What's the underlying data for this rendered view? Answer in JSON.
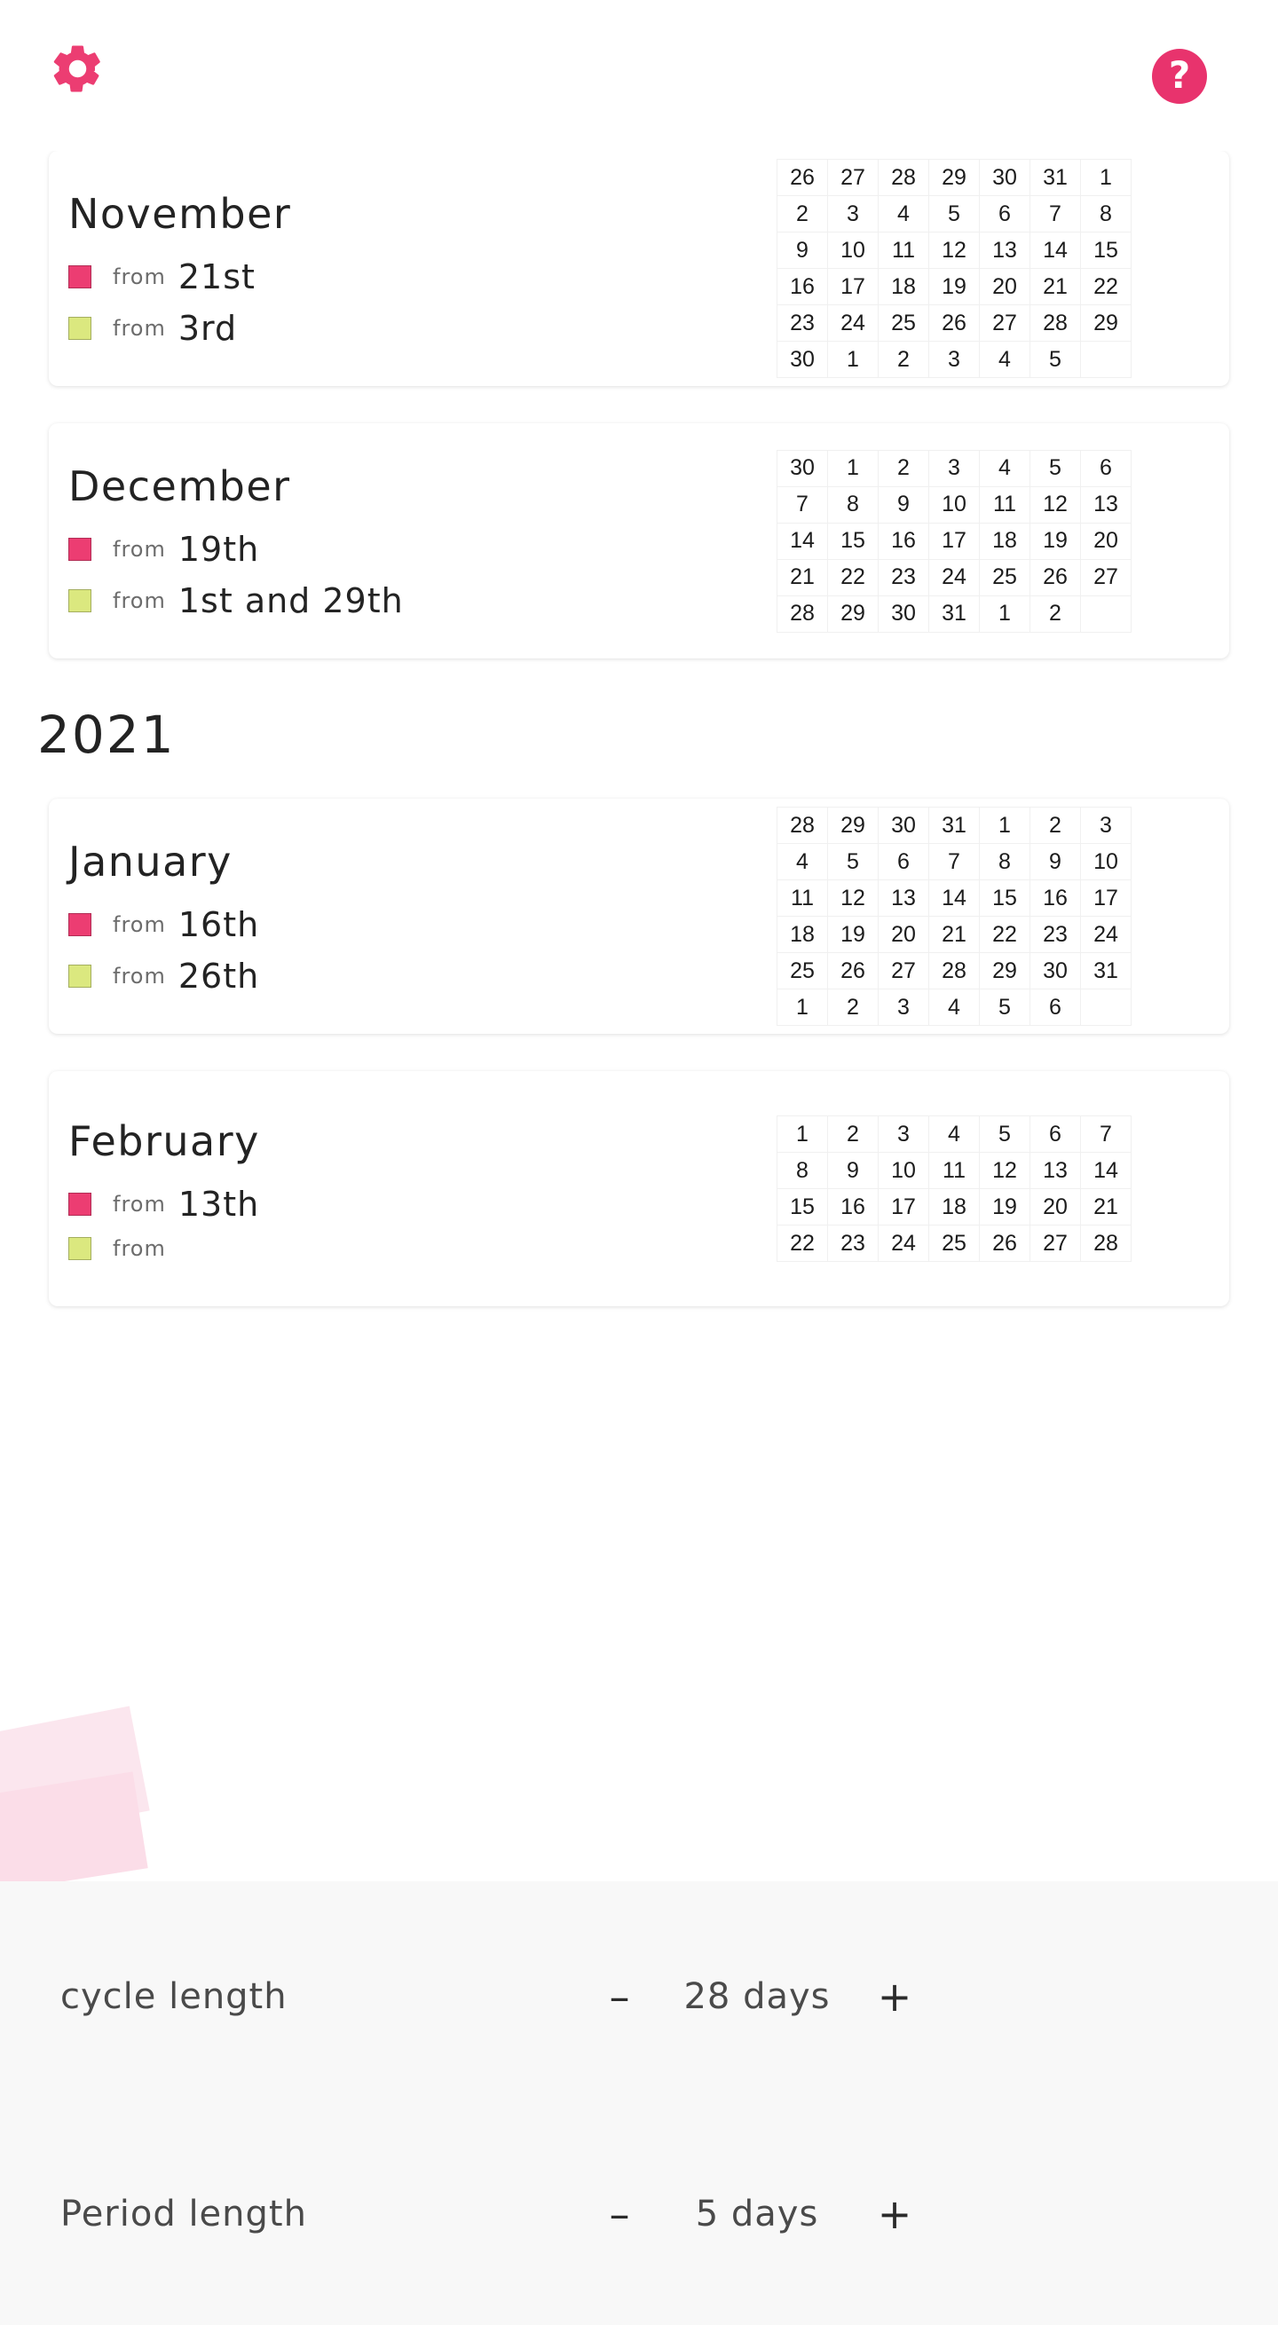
{
  "header": {
    "settings_icon": "gear-icon",
    "help_icon": "question-mark-icon",
    "help_label": "?"
  },
  "legend": {
    "from_label": "from",
    "period_color": "#ec3d72",
    "fertile_color": "#dbe87f"
  },
  "year_2021": "2021",
  "months": [
    {
      "name": "November",
      "period_from": "21st",
      "fertile_from": "3rd",
      "weeks": [
        [
          {
            "d": "26",
            "s": "out"
          },
          {
            "d": "27",
            "s": "out"
          },
          {
            "d": "28",
            "s": "out"
          },
          {
            "d": "29",
            "s": "out"
          },
          {
            "d": "30",
            "s": "out"
          },
          {
            "d": "31",
            "s": "out"
          },
          {
            "d": "1",
            "s": ""
          }
        ],
        [
          {
            "d": "2",
            "s": ""
          },
          {
            "d": "3",
            "s": "g1"
          },
          {
            "d": "4",
            "s": "g2"
          },
          {
            "d": "5",
            "s": "g3"
          },
          {
            "d": "6",
            "s": "g4"
          },
          {
            "d": "7",
            "s": "g3"
          },
          {
            "d": "8",
            "s": "g2"
          }
        ],
        [
          {
            "d": "9",
            "s": "g2"
          },
          {
            "d": "10",
            "s": "g1"
          },
          {
            "d": "11",
            "s": ""
          },
          {
            "d": "12",
            "s": ""
          },
          {
            "d": "13",
            "s": ""
          },
          {
            "d": "14",
            "s": ""
          },
          {
            "d": "15",
            "s": ""
          }
        ],
        [
          {
            "d": "16",
            "s": ""
          },
          {
            "d": "17",
            "s": ""
          },
          {
            "d": "18",
            "s": ""
          },
          {
            "d": "19",
            "s": ""
          },
          {
            "d": "20",
            "s": ""
          },
          {
            "d": "21",
            "s": "p3"
          },
          {
            "d": "22",
            "s": "p4"
          }
        ],
        [
          {
            "d": "23",
            "s": "p3"
          },
          {
            "d": "24",
            "s": "p2"
          },
          {
            "d": "25",
            "s": "p1"
          },
          {
            "d": "26",
            "s": ""
          },
          {
            "d": "27",
            "s": ""
          },
          {
            "d": "28",
            "s": ""
          },
          {
            "d": "29",
            "s": ""
          }
        ],
        [
          {
            "d": "30",
            "s": ""
          },
          {
            "d": "1",
            "s": "out"
          },
          {
            "d": "2",
            "s": "out"
          },
          {
            "d": "3",
            "s": "out"
          },
          {
            "d": "4",
            "s": "out"
          },
          {
            "d": "5",
            "s": "out"
          },
          {
            "d": "",
            "s": "empty"
          }
        ]
      ]
    },
    {
      "name": "December",
      "period_from": "19th",
      "fertile_from": "1st and 29th",
      "weeks": [
        [
          {
            "d": "30",
            "s": "out"
          },
          {
            "d": "1",
            "s": "g1"
          },
          {
            "d": "2",
            "s": "g2"
          },
          {
            "d": "3",
            "s": "g3"
          },
          {
            "d": "4",
            "s": "g4"
          },
          {
            "d": "5",
            "s": "g3"
          },
          {
            "d": "6",
            "s": "g2"
          }
        ],
        [
          {
            "d": "7",
            "s": "g2"
          },
          {
            "d": "8",
            "s": "g1"
          },
          {
            "d": "9",
            "s": ""
          },
          {
            "d": "10",
            "s": ""
          },
          {
            "d": "11",
            "s": ""
          },
          {
            "d": "12",
            "s": ""
          },
          {
            "d": "13",
            "s": ""
          }
        ],
        [
          {
            "d": "14",
            "s": ""
          },
          {
            "d": "15",
            "s": ""
          },
          {
            "d": "16",
            "s": ""
          },
          {
            "d": "17",
            "s": ""
          },
          {
            "d": "18",
            "s": ""
          },
          {
            "d": "19",
            "s": "p3"
          },
          {
            "d": "20",
            "s": "p4"
          }
        ],
        [
          {
            "d": "21",
            "s": "p3"
          },
          {
            "d": "22",
            "s": "p2"
          },
          {
            "d": "23",
            "s": "p1"
          },
          {
            "d": "24",
            "s": ""
          },
          {
            "d": "25",
            "s": ""
          },
          {
            "d": "26",
            "s": ""
          },
          {
            "d": "27",
            "s": ""
          }
        ],
        [
          {
            "d": "28",
            "s": ""
          },
          {
            "d": "29",
            "s": "g1"
          },
          {
            "d": "30",
            "s": "g2"
          },
          {
            "d": "31",
            "s": "g3"
          },
          {
            "d": "1",
            "s": "out"
          },
          {
            "d": "2",
            "s": "out"
          },
          {
            "d": "",
            "s": "empty"
          }
        ]
      ]
    },
    {
      "name": "January",
      "period_from": "16th",
      "fertile_from": "26th",
      "weeks": [
        [
          {
            "d": "28",
            "s": "out"
          },
          {
            "d": "29",
            "s": "out"
          },
          {
            "d": "30",
            "s": "out"
          },
          {
            "d": "31",
            "s": "out"
          },
          {
            "d": "1",
            "s": "g4"
          },
          {
            "d": "2",
            "s": "g3"
          },
          {
            "d": "3",
            "s": "g2"
          }
        ],
        [
          {
            "d": "4",
            "s": "g2"
          },
          {
            "d": "5",
            "s": "g1"
          },
          {
            "d": "6",
            "s": ""
          },
          {
            "d": "7",
            "s": ""
          },
          {
            "d": "8",
            "s": ""
          },
          {
            "d": "9",
            "s": ""
          },
          {
            "d": "10",
            "s": ""
          }
        ],
        [
          {
            "d": "11",
            "s": ""
          },
          {
            "d": "12",
            "s": ""
          },
          {
            "d": "13",
            "s": ""
          },
          {
            "d": "14",
            "s": ""
          },
          {
            "d": "15",
            "s": ""
          },
          {
            "d": "16",
            "s": "p3"
          },
          {
            "d": "17",
            "s": "p4"
          }
        ],
        [
          {
            "d": "18",
            "s": "p3"
          },
          {
            "d": "19",
            "s": "p2"
          },
          {
            "d": "20",
            "s": "p1"
          },
          {
            "d": "21",
            "s": ""
          },
          {
            "d": "22",
            "s": ""
          },
          {
            "d": "23",
            "s": ""
          },
          {
            "d": "24",
            "s": ""
          }
        ],
        [
          {
            "d": "25",
            "s": ""
          },
          {
            "d": "26",
            "s": "g1"
          },
          {
            "d": "27",
            "s": "g2"
          },
          {
            "d": "28",
            "s": "g3"
          },
          {
            "d": "29",
            "s": "g4"
          },
          {
            "d": "30",
            "s": "g3"
          },
          {
            "d": "31",
            "s": "g2"
          }
        ],
        [
          {
            "d": "1",
            "s": "out"
          },
          {
            "d": "2",
            "s": "out"
          },
          {
            "d": "3",
            "s": "out"
          },
          {
            "d": "4",
            "s": "out"
          },
          {
            "d": "5",
            "s": "out"
          },
          {
            "d": "6",
            "s": "out"
          },
          {
            "d": "",
            "s": "empty"
          }
        ]
      ]
    },
    {
      "name": "February",
      "period_from": "13th",
      "fertile_from": "",
      "weeks": [
        [
          {
            "d": "1",
            "s": "g2"
          },
          {
            "d": "2",
            "s": "g1"
          },
          {
            "d": "3",
            "s": ""
          },
          {
            "d": "4",
            "s": ""
          },
          {
            "d": "5",
            "s": ""
          },
          {
            "d": "6",
            "s": ""
          },
          {
            "d": "7",
            "s": ""
          }
        ],
        [
          {
            "d": "8",
            "s": ""
          },
          {
            "d": "9",
            "s": ""
          },
          {
            "d": "10",
            "s": ""
          },
          {
            "d": "11",
            "s": ""
          },
          {
            "d": "12",
            "s": ""
          },
          {
            "d": "13",
            "s": "p3"
          },
          {
            "d": "14",
            "s": "p4"
          }
        ],
        [
          {
            "d": "15",
            "s": "p3"
          },
          {
            "d": "16",
            "s": "p2"
          },
          {
            "d": "17",
            "s": "p1"
          },
          {
            "d": "18",
            "s": ""
          },
          {
            "d": "19",
            "s": ""
          },
          {
            "d": "20",
            "s": ""
          },
          {
            "d": "21",
            "s": ""
          }
        ],
        [
          {
            "d": "22",
            "s": ""
          },
          {
            "d": "23",
            "s": "g1"
          },
          {
            "d": "24",
            "s": "g2"
          },
          {
            "d": "25",
            "s": "g3"
          },
          {
            "d": "26",
            "s": "g4"
          },
          {
            "d": "27",
            "s": "g3"
          },
          {
            "d": "28",
            "s": "g2"
          }
        ]
      ]
    }
  ],
  "settings": {
    "rows": [
      {
        "label": "cycle length",
        "minus": "–",
        "value": "28 days",
        "plus": "+"
      },
      {
        "label": "Period length",
        "minus": "–",
        "value": "5 days",
        "plus": "+"
      }
    ]
  }
}
